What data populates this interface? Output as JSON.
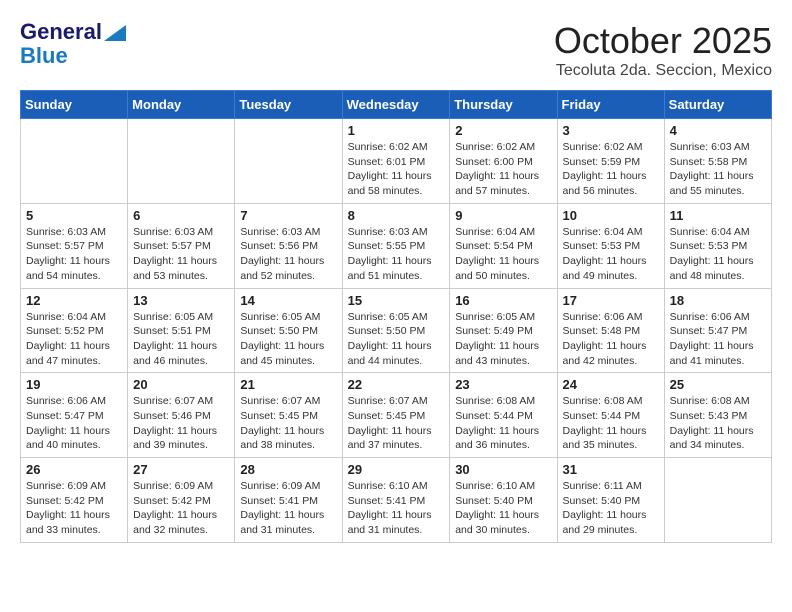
{
  "header": {
    "logo_line1": "General",
    "logo_line2": "Blue",
    "month": "October 2025",
    "location": "Tecoluta 2da. Seccion, Mexico"
  },
  "weekdays": [
    "Sunday",
    "Monday",
    "Tuesday",
    "Wednesday",
    "Thursday",
    "Friday",
    "Saturday"
  ],
  "weeks": [
    [
      {
        "day": "",
        "info": ""
      },
      {
        "day": "",
        "info": ""
      },
      {
        "day": "",
        "info": ""
      },
      {
        "day": "1",
        "info": "Sunrise: 6:02 AM\nSunset: 6:01 PM\nDaylight: 11 hours\nand 58 minutes."
      },
      {
        "day": "2",
        "info": "Sunrise: 6:02 AM\nSunset: 6:00 PM\nDaylight: 11 hours\nand 57 minutes."
      },
      {
        "day": "3",
        "info": "Sunrise: 6:02 AM\nSunset: 5:59 PM\nDaylight: 11 hours\nand 56 minutes."
      },
      {
        "day": "4",
        "info": "Sunrise: 6:03 AM\nSunset: 5:58 PM\nDaylight: 11 hours\nand 55 minutes."
      }
    ],
    [
      {
        "day": "5",
        "info": "Sunrise: 6:03 AM\nSunset: 5:57 PM\nDaylight: 11 hours\nand 54 minutes."
      },
      {
        "day": "6",
        "info": "Sunrise: 6:03 AM\nSunset: 5:57 PM\nDaylight: 11 hours\nand 53 minutes."
      },
      {
        "day": "7",
        "info": "Sunrise: 6:03 AM\nSunset: 5:56 PM\nDaylight: 11 hours\nand 52 minutes."
      },
      {
        "day": "8",
        "info": "Sunrise: 6:03 AM\nSunset: 5:55 PM\nDaylight: 11 hours\nand 51 minutes."
      },
      {
        "day": "9",
        "info": "Sunrise: 6:04 AM\nSunset: 5:54 PM\nDaylight: 11 hours\nand 50 minutes."
      },
      {
        "day": "10",
        "info": "Sunrise: 6:04 AM\nSunset: 5:53 PM\nDaylight: 11 hours\nand 49 minutes."
      },
      {
        "day": "11",
        "info": "Sunrise: 6:04 AM\nSunset: 5:53 PM\nDaylight: 11 hours\nand 48 minutes."
      }
    ],
    [
      {
        "day": "12",
        "info": "Sunrise: 6:04 AM\nSunset: 5:52 PM\nDaylight: 11 hours\nand 47 minutes."
      },
      {
        "day": "13",
        "info": "Sunrise: 6:05 AM\nSunset: 5:51 PM\nDaylight: 11 hours\nand 46 minutes."
      },
      {
        "day": "14",
        "info": "Sunrise: 6:05 AM\nSunset: 5:50 PM\nDaylight: 11 hours\nand 45 minutes."
      },
      {
        "day": "15",
        "info": "Sunrise: 6:05 AM\nSunset: 5:50 PM\nDaylight: 11 hours\nand 44 minutes."
      },
      {
        "day": "16",
        "info": "Sunrise: 6:05 AM\nSunset: 5:49 PM\nDaylight: 11 hours\nand 43 minutes."
      },
      {
        "day": "17",
        "info": "Sunrise: 6:06 AM\nSunset: 5:48 PM\nDaylight: 11 hours\nand 42 minutes."
      },
      {
        "day": "18",
        "info": "Sunrise: 6:06 AM\nSunset: 5:47 PM\nDaylight: 11 hours\nand 41 minutes."
      }
    ],
    [
      {
        "day": "19",
        "info": "Sunrise: 6:06 AM\nSunset: 5:47 PM\nDaylight: 11 hours\nand 40 minutes."
      },
      {
        "day": "20",
        "info": "Sunrise: 6:07 AM\nSunset: 5:46 PM\nDaylight: 11 hours\nand 39 minutes."
      },
      {
        "day": "21",
        "info": "Sunrise: 6:07 AM\nSunset: 5:45 PM\nDaylight: 11 hours\nand 38 minutes."
      },
      {
        "day": "22",
        "info": "Sunrise: 6:07 AM\nSunset: 5:45 PM\nDaylight: 11 hours\nand 37 minutes."
      },
      {
        "day": "23",
        "info": "Sunrise: 6:08 AM\nSunset: 5:44 PM\nDaylight: 11 hours\nand 36 minutes."
      },
      {
        "day": "24",
        "info": "Sunrise: 6:08 AM\nSunset: 5:44 PM\nDaylight: 11 hours\nand 35 minutes."
      },
      {
        "day": "25",
        "info": "Sunrise: 6:08 AM\nSunset: 5:43 PM\nDaylight: 11 hours\nand 34 minutes."
      }
    ],
    [
      {
        "day": "26",
        "info": "Sunrise: 6:09 AM\nSunset: 5:42 PM\nDaylight: 11 hours\nand 33 minutes."
      },
      {
        "day": "27",
        "info": "Sunrise: 6:09 AM\nSunset: 5:42 PM\nDaylight: 11 hours\nand 32 minutes."
      },
      {
        "day": "28",
        "info": "Sunrise: 6:09 AM\nSunset: 5:41 PM\nDaylight: 11 hours\nand 31 minutes."
      },
      {
        "day": "29",
        "info": "Sunrise: 6:10 AM\nSunset: 5:41 PM\nDaylight: 11 hours\nand 31 minutes."
      },
      {
        "day": "30",
        "info": "Sunrise: 6:10 AM\nSunset: 5:40 PM\nDaylight: 11 hours\nand 30 minutes."
      },
      {
        "day": "31",
        "info": "Sunrise: 6:11 AM\nSunset: 5:40 PM\nDaylight: 11 hours\nand 29 minutes."
      },
      {
        "day": "",
        "info": ""
      }
    ]
  ]
}
